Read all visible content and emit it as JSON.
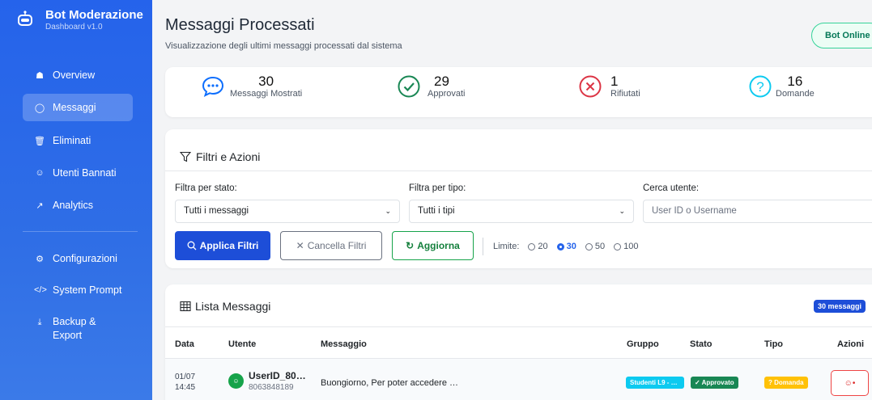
{
  "brand": {
    "title": "Bot Moderazione",
    "subtitle": "Dashboard v1.0"
  },
  "nav": [
    {
      "label": "Overview",
      "icon": "house-icon",
      "active": false
    },
    {
      "label": "Messaggi",
      "icon": "chat-icon",
      "active": true
    },
    {
      "label": "Eliminati",
      "icon": "trash-icon",
      "active": false
    },
    {
      "label": "Utenti Bannati",
      "icon": "user-ban-icon",
      "active": false
    },
    {
      "label": "Analytics",
      "icon": "chart-line-icon",
      "active": false
    },
    {
      "label": "Configurazioni",
      "icon": "gear-icon",
      "active": false
    },
    {
      "label": "System Prompt",
      "icon": "code-icon",
      "active": false
    },
    {
      "label": "Backup & Export",
      "icon": "download-icon",
      "active": false
    }
  ],
  "header": {
    "title": "Messaggi Processati",
    "subtitle": "Visualizzazione degli ultimi messaggi processati dal sistema",
    "status": "Bot Online"
  },
  "stats": [
    {
      "value": "30",
      "label": "Messaggi Mostrati",
      "icon": "chat-dots-icon",
      "color": "#0d6efd"
    },
    {
      "value": "29",
      "label": "Approvati",
      "icon": "check-circle-icon",
      "color": "#198754"
    },
    {
      "value": "1",
      "label": "Rifiutati",
      "icon": "x-circle-icon",
      "color": "#dc3545"
    },
    {
      "value": "16",
      "label": "Domande",
      "icon": "question-circle-icon",
      "color": "#0dcaf0"
    }
  ],
  "filters": {
    "title": "Filtri e Azioni",
    "status_label": "Filtra per stato:",
    "status_value": "Tutti i messaggi",
    "type_label": "Filtra per tipo:",
    "type_value": "Tutti i tipi",
    "search_label": "Cerca utente:",
    "search_placeholder": "User ID o Username",
    "apply": "Applica Filtri",
    "clear": "Cancella Filtri",
    "refresh": "Aggiorna",
    "limit_label": "Limite:",
    "limits": [
      "20",
      "30",
      "50",
      "100"
    ],
    "limit_selected": "30"
  },
  "list": {
    "title": "Lista Messaggi",
    "count": "30 messaggi",
    "columns": [
      "Data",
      "Utente",
      "Messaggio",
      "Gruppo",
      "Stato",
      "Tipo",
      "Azioni"
    ],
    "rows": [
      {
        "date": "01/07",
        "time": "14:45",
        "user": "UserID_80…",
        "user_id": "8063848189",
        "message": "Buongiorno, Per poter accedere …",
        "group": "Studenti L9 - …",
        "status": "✓ Approvato",
        "type": "? Domanda"
      }
    ]
  },
  "colors": {
    "primary": "#1d4ed8",
    "success": "#16a34a",
    "danger": "#dc2626",
    "info": "#0dcaf0",
    "warning": "#ffc107"
  }
}
